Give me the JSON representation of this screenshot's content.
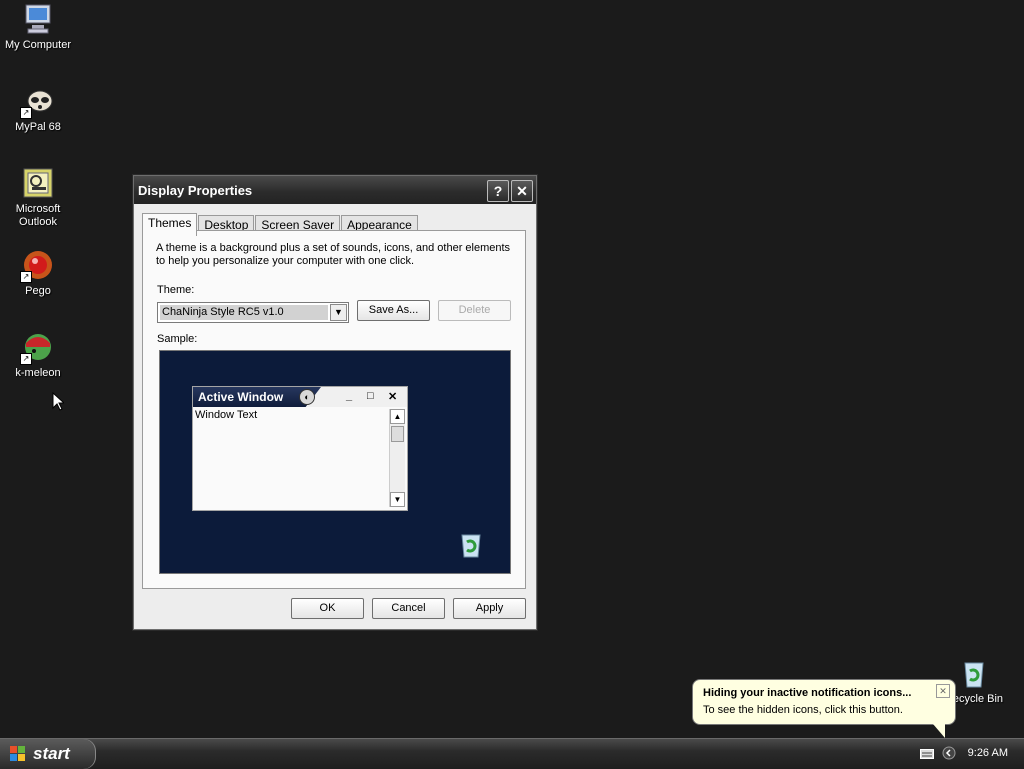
{
  "desktop": {
    "icons": [
      {
        "label": "My Computer",
        "icon": "computer-icon"
      },
      {
        "label": "MyPal 68",
        "icon": "raccoon-icon"
      },
      {
        "label": "Microsoft Outlook",
        "icon": "outlook-icon"
      },
      {
        "label": "Pego",
        "icon": "pego-icon"
      },
      {
        "label": "k-meleon",
        "icon": "kmeleon-icon"
      },
      {
        "label": "Recycle Bin",
        "icon": "recycle-bin-icon"
      }
    ]
  },
  "dialog": {
    "title": "Display Properties",
    "help_glyph": "?",
    "close_glyph": "✕",
    "tabs": [
      "Themes",
      "Desktop",
      "Screen Saver",
      "Appearance"
    ],
    "active_tab": "Themes",
    "description": "A theme is a background plus a set of sounds, icons, and other elements to help you personalize your computer with one click.",
    "theme_label": "Theme:",
    "theme_value": "ChaNinja Style RC5 v1.0",
    "save_as": "Save As...",
    "delete": "Delete",
    "sample_label": "Sample:",
    "sample": {
      "active_window": "Active Window",
      "window_text": "Window Text"
    },
    "ok": "OK",
    "cancel": "Cancel",
    "apply": "Apply"
  },
  "taskbar": {
    "start_label": "start",
    "clock": "9:26 AM"
  },
  "balloon": {
    "title": "Hiding your inactive notification icons...",
    "text": "To see the hidden icons, click this button."
  },
  "colors": {
    "desktop_bg": "#1b1b1b",
    "sample_bg": "#0c1b3a",
    "balloon_bg": "#ffffe1"
  }
}
